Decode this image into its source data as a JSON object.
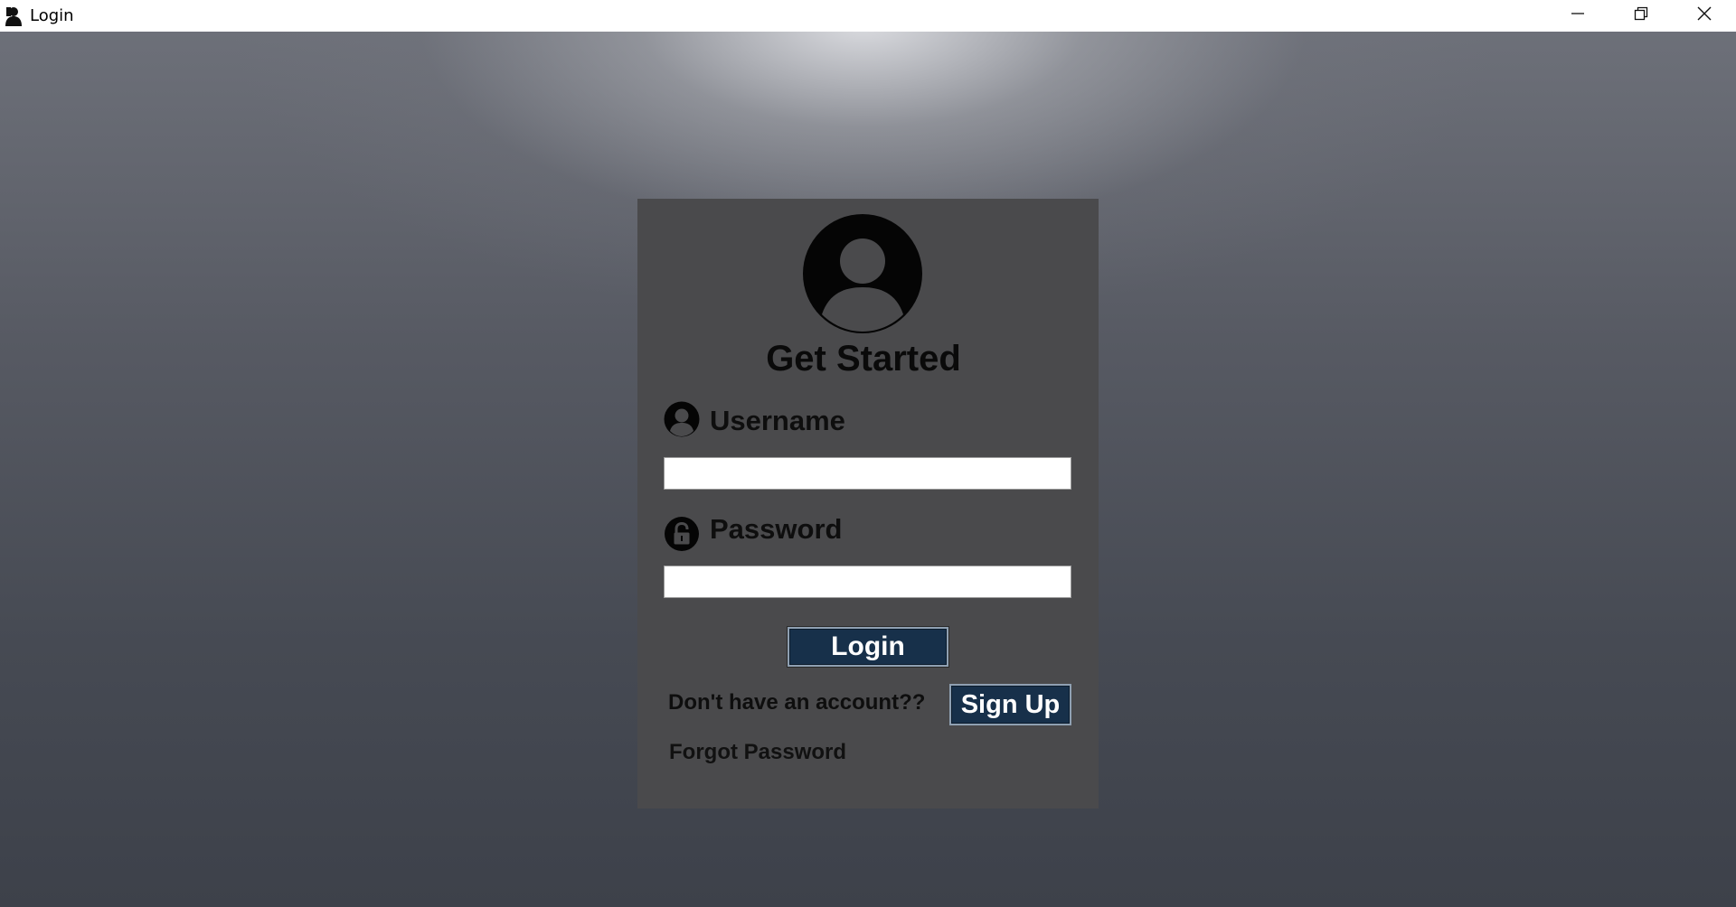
{
  "window": {
    "title": "Login",
    "icon": "user-silhouette-icon",
    "controls": [
      "minimize-icon",
      "restore-icon",
      "close-icon"
    ]
  },
  "card": {
    "heading": "Get Started",
    "avatar_icon": "user-circle-icon",
    "username": {
      "label": "Username",
      "icon": "user-icon",
      "value": "",
      "placeholder": ""
    },
    "password": {
      "label": "Password",
      "icon": "lock-icon",
      "value": "",
      "placeholder": ""
    },
    "login_button": "Login",
    "no_account_text": "Don't have an account??",
    "signup_button": "Sign Up",
    "forgot_link": "Forgot Password"
  },
  "colors": {
    "card_bg": "#4a4a4c",
    "button_bg": "#17304a",
    "button_text": "#ffffff",
    "label_text": "#0e0e0e"
  }
}
